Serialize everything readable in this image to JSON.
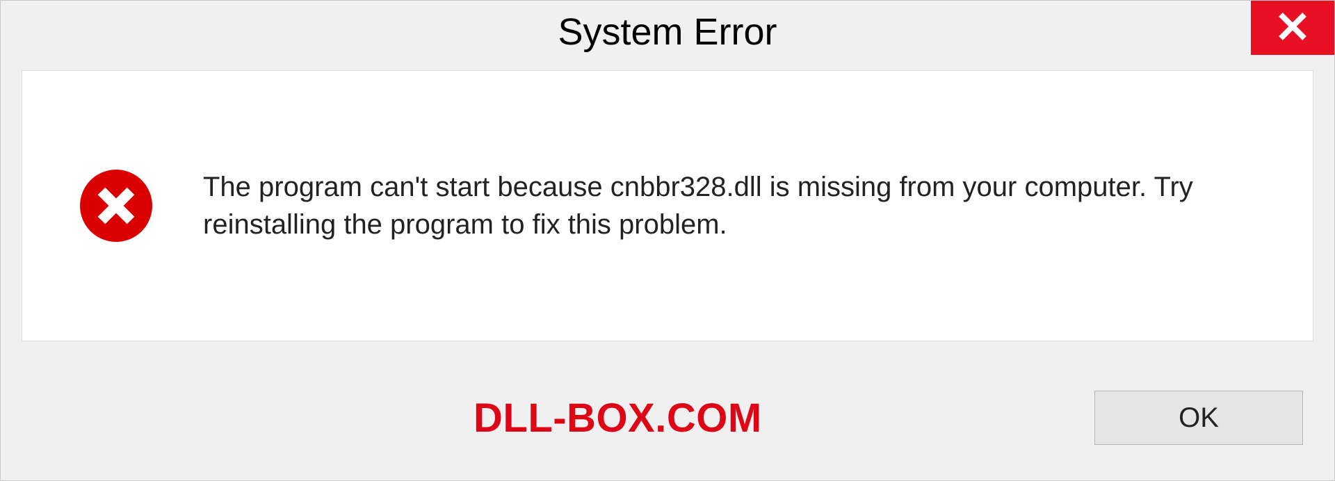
{
  "title": "System Error",
  "message": "The program can't start because cnbbr328.dll is missing from your computer. Try reinstalling the program to fix this problem.",
  "ok_label": "OK",
  "watermark": "DLL-BOX.COM"
}
